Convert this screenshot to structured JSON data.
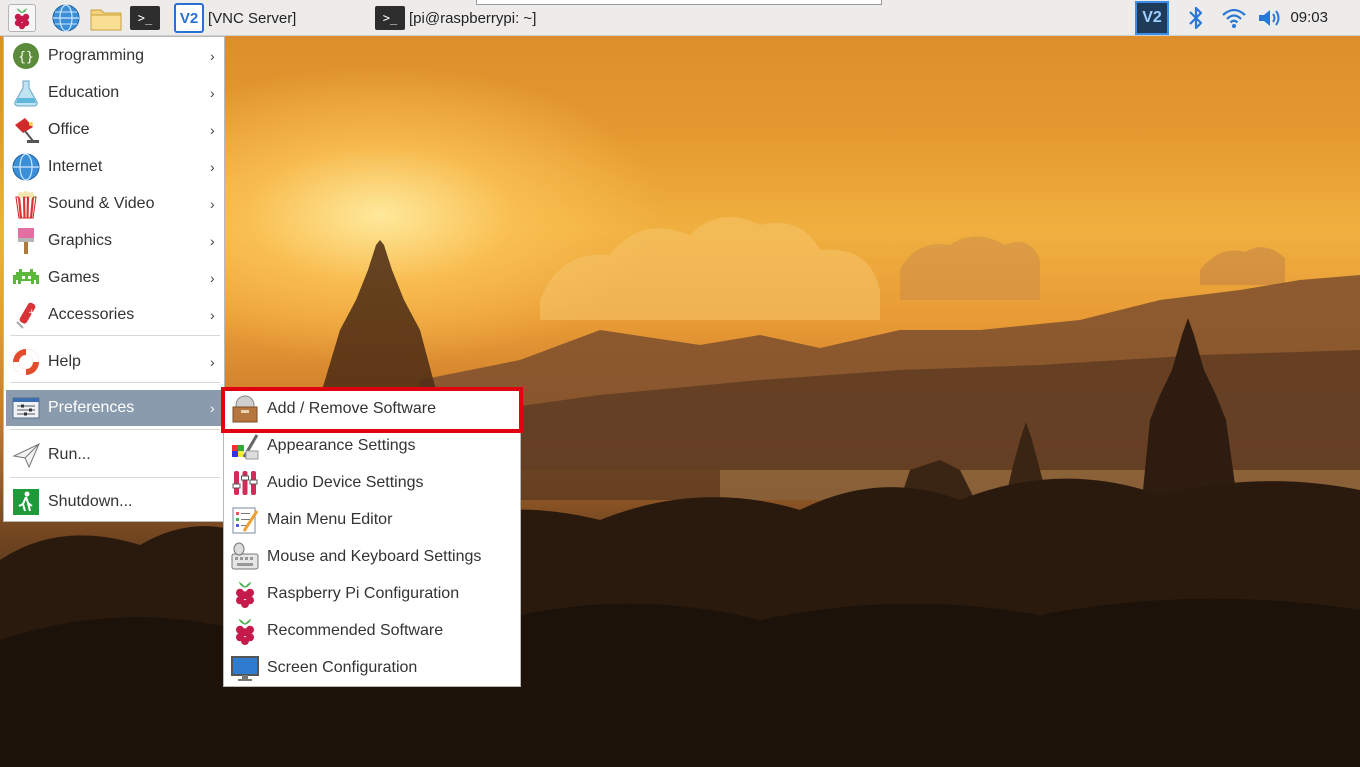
{
  "taskbar": {
    "launchers": [
      {
        "name": "raspberry-menu",
        "icon": "raspberry-icon"
      },
      {
        "name": "web-browser",
        "icon": "globe-icon"
      },
      {
        "name": "file-manager",
        "icon": "folder-icon"
      },
      {
        "name": "terminal",
        "icon": "terminal-icon"
      }
    ],
    "tasks": [
      {
        "label": "[VNC Server]",
        "icon": "vnc-icon"
      },
      {
        "label": "[pi@raspberrypi: ~]",
        "icon": "terminal-icon"
      }
    ],
    "tray": {
      "vnc_icon": "vnc-icon",
      "bluetooth_icon": "bluetooth-icon",
      "wifi_icon": "wifi-icon",
      "volume_icon": "volume-icon",
      "clock": "09:03"
    },
    "terminal_glyph": ">_",
    "vnc_glyph": "V2"
  },
  "main_menu": {
    "items": [
      {
        "label": "Programming",
        "icon": "programming-icon"
      },
      {
        "label": "Education",
        "icon": "education-icon"
      },
      {
        "label": "Office",
        "icon": "office-icon"
      },
      {
        "label": "Internet",
        "icon": "internet-icon"
      },
      {
        "label": "Sound & Video",
        "icon": "sound-video-icon"
      },
      {
        "label": "Graphics",
        "icon": "graphics-icon"
      },
      {
        "label": "Games",
        "icon": "games-icon"
      },
      {
        "label": "Accessories",
        "icon": "accessories-icon"
      },
      {
        "label": "Help",
        "icon": "help-icon"
      },
      {
        "label": "Preferences",
        "icon": "preferences-icon",
        "active": true
      },
      {
        "label": "Run...",
        "icon": "run-icon"
      },
      {
        "label": "Shutdown...",
        "icon": "shutdown-icon"
      }
    ],
    "arrow_glyph": "›"
  },
  "preferences_submenu": {
    "items": [
      {
        "label": "Add / Remove Software",
        "icon": "package-icon",
        "highlighted": true
      },
      {
        "label": "Appearance Settings",
        "icon": "appearance-icon"
      },
      {
        "label": "Audio Device Settings",
        "icon": "audio-settings-icon"
      },
      {
        "label": "Main Menu Editor",
        "icon": "menu-editor-icon"
      },
      {
        "label": "Mouse and Keyboard Settings",
        "icon": "keyboard-mouse-icon"
      },
      {
        "label": "Raspberry Pi Configuration",
        "icon": "raspberry-icon"
      },
      {
        "label": "Recommended Software",
        "icon": "raspberry-icon"
      },
      {
        "label": "Screen Configuration",
        "icon": "monitor-icon"
      }
    ]
  },
  "colors": {
    "active_menu_bg": "#8a9bad",
    "highlight_border": "#e1000f",
    "taskbar_bg": "#edeceb"
  }
}
